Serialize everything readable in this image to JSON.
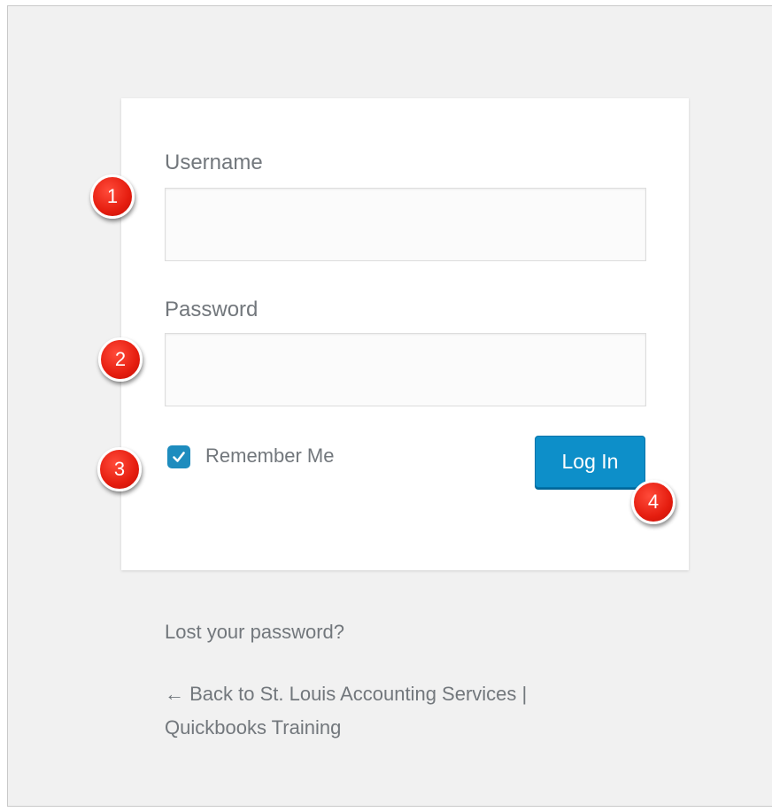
{
  "login_form": {
    "username_label": "Username",
    "username_value": "",
    "password_label": "Password",
    "password_value": "",
    "remember_label": "Remember Me",
    "remember_checked": true,
    "login_button_label": "Log In"
  },
  "markers": {
    "m1": "1",
    "m2": "2",
    "m3": "3",
    "m4": "4"
  },
  "links": {
    "lost_password": "Lost your password?",
    "back_to_site": "← Back to St. Louis Accounting Services | Quickbooks Training"
  },
  "icons": {
    "checkbox": "checkmark-icon"
  },
  "colors": {
    "accent": "#0d8fc9",
    "marker": "#e51d0f",
    "background": "#f1f1f1"
  }
}
